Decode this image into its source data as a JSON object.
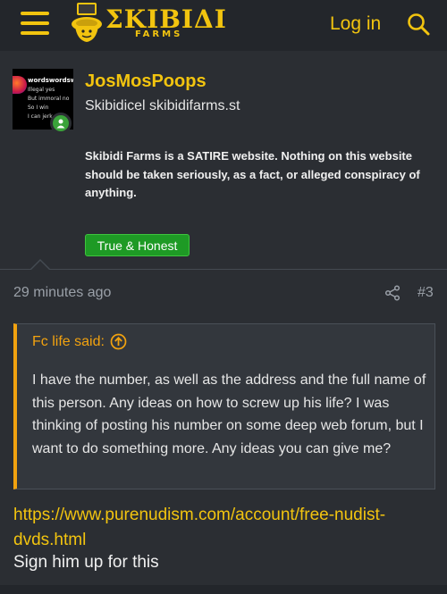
{
  "header": {
    "logo_title": "ΣKIBIΔI",
    "logo_sub": "FARMS",
    "login_label": "Log in",
    "menu_icon": "hamburger-icon",
    "search_icon": "search-icon"
  },
  "post": {
    "username": "JosMosPoops",
    "user_title": "Skibidicel skibidifarms.st",
    "disclaimer": "Skibidi Farms is a SATIRE website. Nothing on this website should be taken seriously, as a fact, or alleged conspiracy of anything.",
    "badge": "True & Honest",
    "avatar_text": [
      "wordswordsword",
      "Illegal yes",
      "But immoral no",
      "So I win",
      "I can jerk"
    ],
    "timestamp": "29 minutes ago",
    "post_number": "#3",
    "quote": {
      "attribution": "Fc life said:",
      "body": "I have the number, as well as the address and the full name of this person. Any ideas on how to screw up his life? I was thinking of posting his number on some deep web forum, but I want to do something more. Any ideas you can give me?"
    },
    "link": "https://www.purenudism.com/account/free-nudist-dvds.html",
    "reply": "Sign him up for this"
  },
  "colors": {
    "accent": "#f2c40f",
    "quote_accent": "#f2a20f",
    "background": "#2b2e33",
    "header_bg": "#23262b",
    "badge_green": "#1e9a25"
  }
}
